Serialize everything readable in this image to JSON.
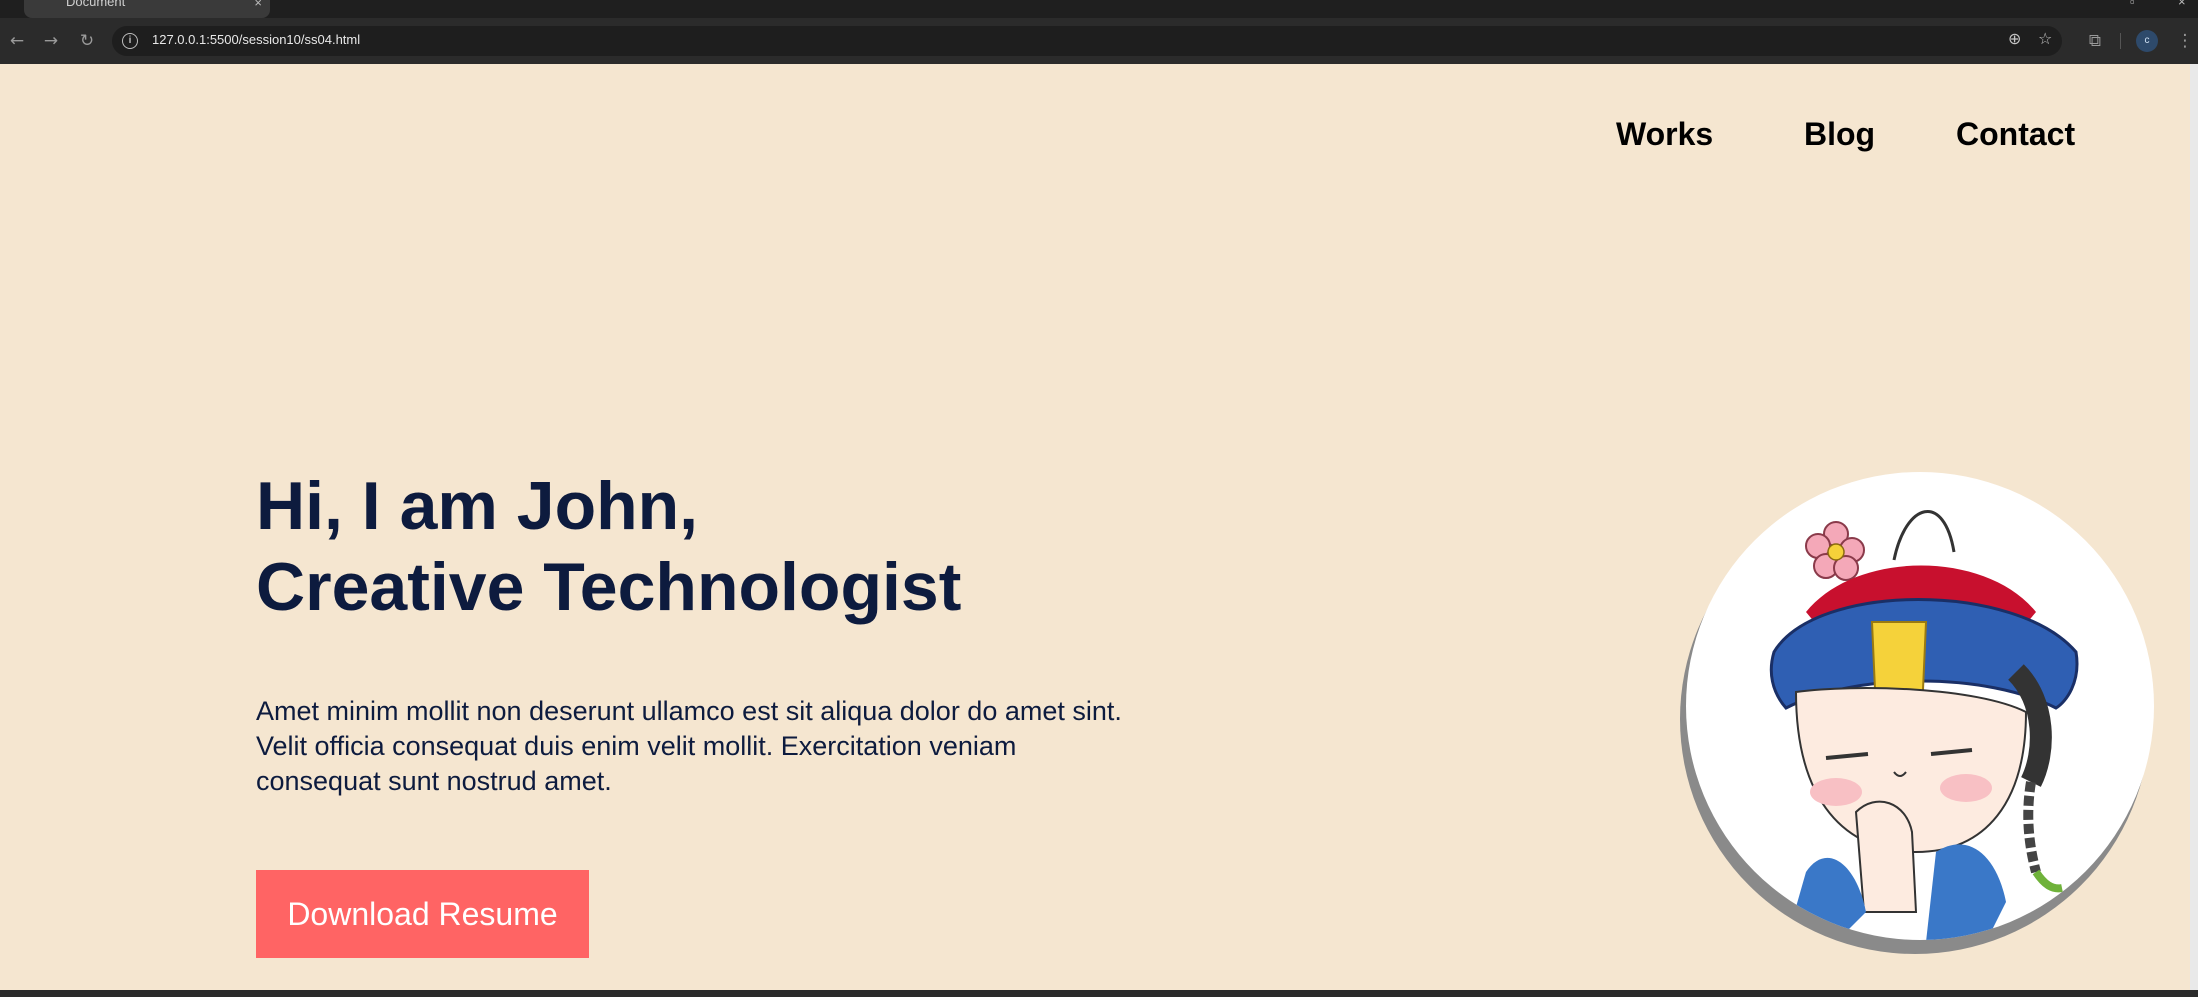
{
  "browser": {
    "tab_title": "Document",
    "url": "127.0.0.1:5500/session10/ss04.html",
    "profile_initial": "c"
  },
  "nav": {
    "items": [
      "Works",
      "Blog",
      "Contact"
    ]
  },
  "hero": {
    "headline_line1": "Hi, I am John,",
    "headline_line2": "Creative Technologist",
    "description": "Amet minim mollit non deserunt ullamco est sit aliqua dolor do amet sint. Velit officia consequat duis enim velit mollit. Exercitation veniam consequat sunt nostrud amet.",
    "cta_label": "Download Resume"
  },
  "colors": {
    "background": "#f5e6d0",
    "heading": "#0d1b3e",
    "cta": "#ff6464",
    "avatar_shadow": "#8a8a8a"
  },
  "icons": [
    "back-icon",
    "forward-icon",
    "reload-icon",
    "info-icon",
    "zoom-icon",
    "star-icon",
    "extensions-icon",
    "menu-icon",
    "avatar-illustration"
  ]
}
